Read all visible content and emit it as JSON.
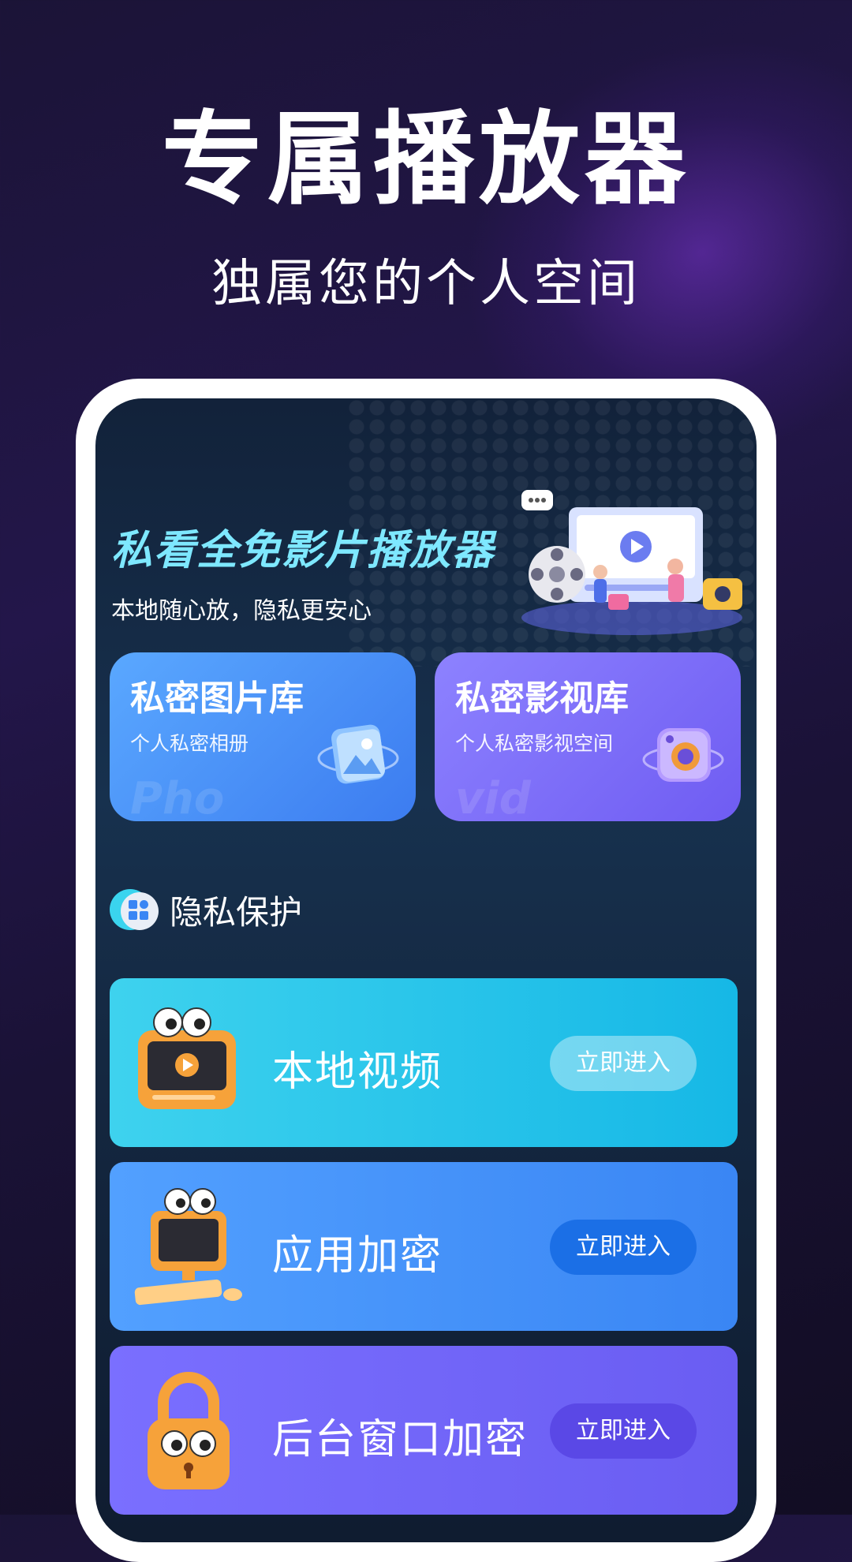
{
  "headline": "专属播放器",
  "subheadline": "独属您的个人空间",
  "app": {
    "title": "私看全免影片播放器",
    "subtitle": "本地随心放，隐私更安心"
  },
  "cards": [
    {
      "title": "私密图片库",
      "subtitle": "个人私密相册",
      "watermark": "Pho",
      "icon": "photo-album-icon"
    },
    {
      "title": "私密影视库",
      "subtitle": "个人私密影视空间",
      "watermark": "vid",
      "icon": "camera-icon"
    }
  ],
  "section": {
    "label": "隐私保护",
    "icon": "apps-grid-icon"
  },
  "features": [
    {
      "label": "本地视频",
      "button": "立即进入",
      "icon": "video-player-mascot-icon"
    },
    {
      "label": "应用加密",
      "button": "立即进入",
      "icon": "computer-mascot-icon"
    },
    {
      "label": "后台窗口加密",
      "button": "立即进入",
      "icon": "padlock-mascot-icon"
    }
  ],
  "colors": {
    "accent_cyan": "#7ee8ff",
    "row1": "#16b8e6",
    "row2": "#3a86f4",
    "row3": "#6a5df2"
  }
}
